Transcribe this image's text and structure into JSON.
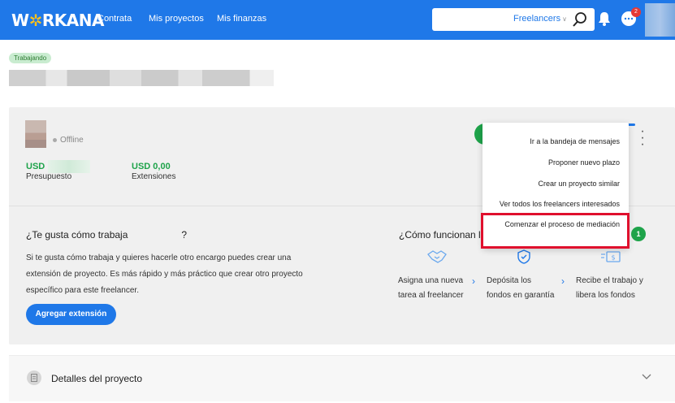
{
  "header": {
    "logo_pre": "W",
    "logo_star": "✲",
    "logo_post": "RKANA",
    "nav": [
      "Contrata",
      "Mis proyectos",
      "Mis finanzas"
    ],
    "search": {
      "value": "",
      "placeholder": "",
      "category": "Freelancers"
    },
    "notifications_badge": "2"
  },
  "project": {
    "status": "Trabajando",
    "freelancer_status": "Offline",
    "budget_value": "USD ·",
    "budget_label": "Presupuesto",
    "extensions_value": "USD 0,00",
    "extensions_label": "Extensiones"
  },
  "left_panel": {
    "title_start": "¿Te gusta cómo trabaja",
    "title_end": "?",
    "text": "Si te gusta cómo trabaja y quieres hacerle otro encargo puedes crear una extensión de proyecto. Es más rápido y más práctico que crear otro proyecto específico para este freelancer.",
    "button": "Agregar extensión"
  },
  "right_panel": {
    "title": "¿Cómo funcionan la",
    "steps": [
      {
        "icon": "handshake-icon",
        "line1": "Asigna una nueva",
        "line2": "tarea al freelancer"
      },
      {
        "icon": "shield-check-icon",
        "line1": "Depósita los",
        "line2": "fondos en garantía"
      },
      {
        "icon": "money-icon",
        "line1": "Recibe el trabajo y",
        "line2": "libera los fondos"
      }
    ]
  },
  "dropdown": {
    "items": [
      "Ir a la bandeja de mensajes",
      "Proponer nuevo plazo",
      "Crear un proyecto similar",
      "Ver todos los freelancers interesados",
      "Comenzar el proceso de mediación"
    ],
    "step_badge": "1"
  },
  "details": {
    "title": "Detalles del proyecto"
  },
  "colors": {
    "brand": "#1f78e8",
    "green": "#1ea34a",
    "highlight": "#e0102d"
  }
}
